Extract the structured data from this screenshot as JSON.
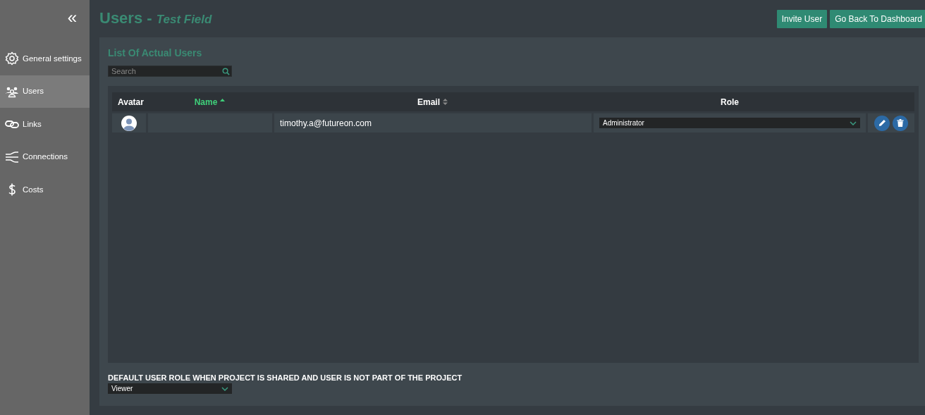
{
  "sidebar": {
    "collapse_glyph": "«",
    "items": [
      {
        "label": "General settings",
        "selected": false
      },
      {
        "label": "Users",
        "selected": true
      },
      {
        "label": "Links",
        "selected": false
      },
      {
        "label": "Connections",
        "selected": false
      },
      {
        "label": "Costs",
        "selected": false
      }
    ]
  },
  "header": {
    "title": "Users",
    "separator": "-",
    "subtitle": "Test Field",
    "buttons": [
      "Invite User",
      "Go Back To Dashboard"
    ]
  },
  "panel": {
    "title": "List Of Actual Users",
    "search": {
      "placeholder": "Search"
    },
    "table": {
      "columns": [
        {
          "label": "Avatar",
          "sortable": false,
          "sorted": false
        },
        {
          "label": "Name",
          "sortable": true,
          "sorted": true
        },
        {
          "label": "Email",
          "sortable": true,
          "sorted": false
        },
        {
          "label": "Role",
          "sortable": false,
          "sorted": false
        }
      ],
      "rows": [
        {
          "name": "",
          "email": "timothy.a@futureon.com",
          "role": "Administrator"
        }
      ]
    },
    "default_role": {
      "label": "DEFAULT USER ROLE WHEN PROJECT IS SHARED AND USER IS NOT PART OF THE PROJECT",
      "value": "Viewer"
    }
  }
}
